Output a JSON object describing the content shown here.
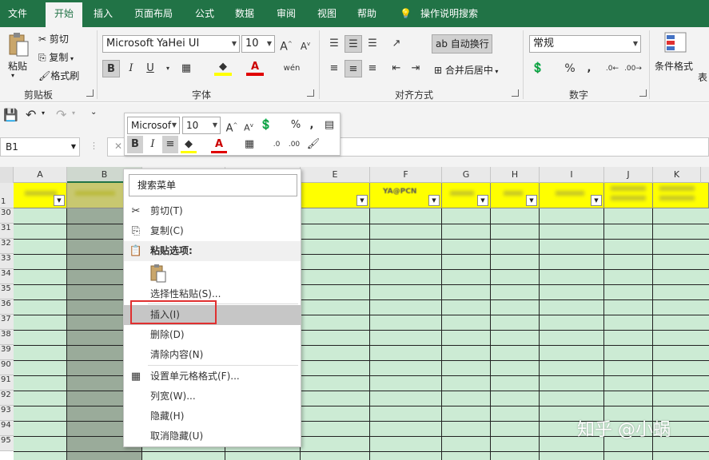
{
  "ribbon_tabs": [
    "文件",
    "开始",
    "插入",
    "页面布局",
    "公式",
    "数据",
    "审阅",
    "视图",
    "帮助"
  ],
  "tell_me": "操作说明搜索",
  "clipboard": {
    "paste": "粘贴",
    "cut": "剪切",
    "copy": "复制",
    "format_painter": "格式刷",
    "group": "剪贴板"
  },
  "font": {
    "name": "Microsoft YaHei UI",
    "size": "10",
    "bold": "B",
    "italic": "I",
    "underline": "U",
    "grow": "A",
    "shrink": "A",
    "phonetic": "wén",
    "group": "字体"
  },
  "alignment": {
    "wrap_text": "自动换行",
    "merge_center": "合并后居中",
    "group": "对齐方式"
  },
  "number": {
    "format": "常规",
    "percent": "%",
    "comma": ",",
    "group": "数字"
  },
  "styles": {
    "conditional": "条件格式",
    "table": "表"
  },
  "name_box": "B1",
  "mini_toolbar": {
    "font": "Microsof",
    "size": "10",
    "percent": "%",
    "comma": ","
  },
  "columns": [
    "A",
    "B",
    "C",
    "D",
    "E",
    "F",
    "G",
    "H",
    "I",
    "J",
    "K"
  ],
  "rows": [
    "1",
    "30",
    "31",
    "32",
    "33",
    "34",
    "35",
    "36",
    "37",
    "38",
    "39",
    "90",
    "91",
    "92",
    "93",
    "94",
    "95"
  ],
  "header_cell_f": "YA@PCN",
  "context_menu": {
    "search": "搜索菜单",
    "items": [
      "剪切(T)",
      "复制(C)",
      "粘贴选项:",
      "选择性粘贴(S)...",
      "插入(I)",
      "删除(D)",
      "清除内容(N)",
      "设置单元格格式(F)...",
      "列宽(W)...",
      "隐藏(H)",
      "取消隐藏(U)"
    ]
  },
  "watermark": "知乎 @小蜗",
  "colors": {
    "excel_green": "#217346",
    "header_yellow": "#ffff00",
    "cell_green": "#ccebd4",
    "selected_col": "#9aab9a",
    "highlight_box": "#e03030"
  }
}
